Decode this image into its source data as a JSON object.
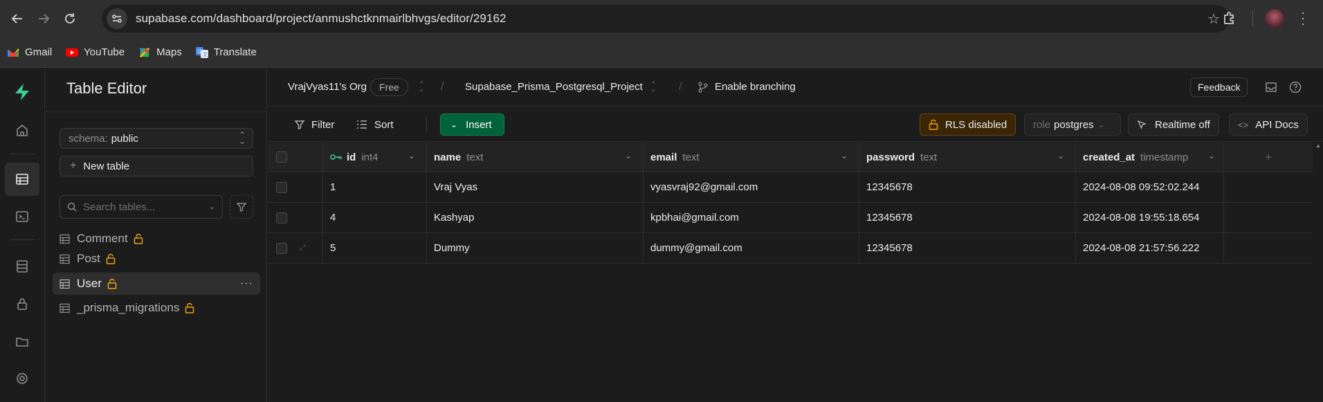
{
  "browser": {
    "url": "supabase.com/dashboard/project/anmushctknmairlbhvgs/editor/29162",
    "bookmarks": [
      {
        "label": "Gmail",
        "icon": "gmail-icon"
      },
      {
        "label": "YouTube",
        "icon": "youtube-icon"
      },
      {
        "label": "Maps",
        "icon": "maps-icon"
      },
      {
        "label": "Translate",
        "icon": "translate-icon"
      }
    ]
  },
  "sidebar": {
    "title": "Table Editor",
    "schema_label": "schema:",
    "schema_value": "public",
    "new_table_label": "New table",
    "search_placeholder": "Search tables...",
    "tables": [
      {
        "label": "Comment",
        "active": false
      },
      {
        "label": "Post",
        "active": false
      },
      {
        "label": "User",
        "active": true
      },
      {
        "label": "_prisma_migrations",
        "active": false
      }
    ]
  },
  "topbar": {
    "org": "VrajVyas11's Org",
    "plan": "Free",
    "project": "Supabase_Prisma_Postgresql_Project",
    "branching": "Enable branching",
    "feedback": "Feedback"
  },
  "toolbar": {
    "filter": "Filter",
    "sort": "Sort",
    "insert": "Insert",
    "rls": "RLS disabled",
    "role_key": "role",
    "role_value": "postgres",
    "realtime": "Realtime off",
    "api_docs": "API Docs"
  },
  "table": {
    "columns": [
      {
        "name": "id",
        "type": "int4"
      },
      {
        "name": "name",
        "type": "text"
      },
      {
        "name": "email",
        "type": "text"
      },
      {
        "name": "password",
        "type": "text"
      },
      {
        "name": "created_at",
        "type": "timestamp"
      }
    ],
    "add_column": "+",
    "rows": [
      [
        "1",
        "Vraj Vyas",
        "vyasvraj92@gmail.com",
        "12345678",
        "2024-08-08 09:52:02.244"
      ],
      [
        "4",
        "Kashyap",
        "kpbhai@gmail.com",
        "12345678",
        "2024-08-08 19:55:18.654"
      ],
      [
        "5",
        "Dummy",
        "dummy@gmail.com",
        "12345678",
        "2024-08-08 21:57:56.222"
      ]
    ]
  },
  "colors": {
    "brand": "#3ecf8e",
    "insert_bg": "#006239",
    "rls_bg": "#3a2507",
    "lock": "#f1a10d"
  }
}
